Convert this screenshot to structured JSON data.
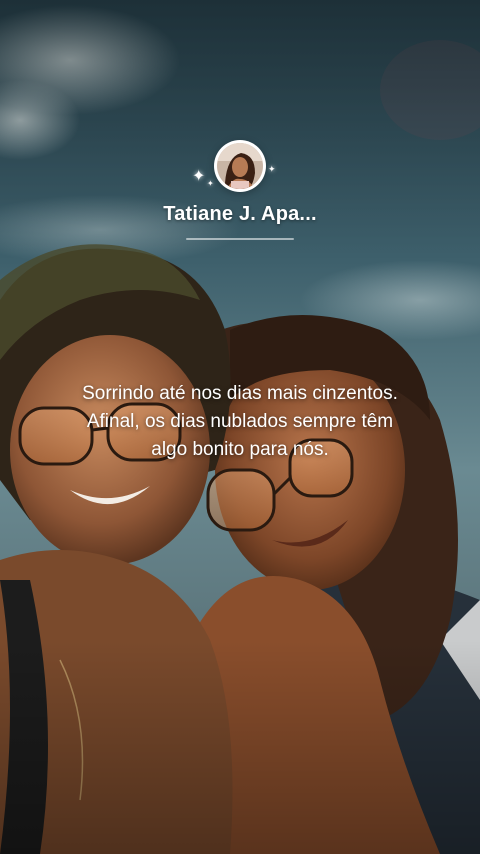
{
  "profile": {
    "name": "Tatiane J. Apa...",
    "avatar_icon": "profile-photo"
  },
  "post": {
    "caption": "Sorrindo até nos dias mais cinzentos. Afinal, os dias nublados sempre têm algo bonito para nós."
  },
  "colors": {
    "text": "#ffffff",
    "sky": "#3d5f6b",
    "divider": "#c9d3d6"
  }
}
